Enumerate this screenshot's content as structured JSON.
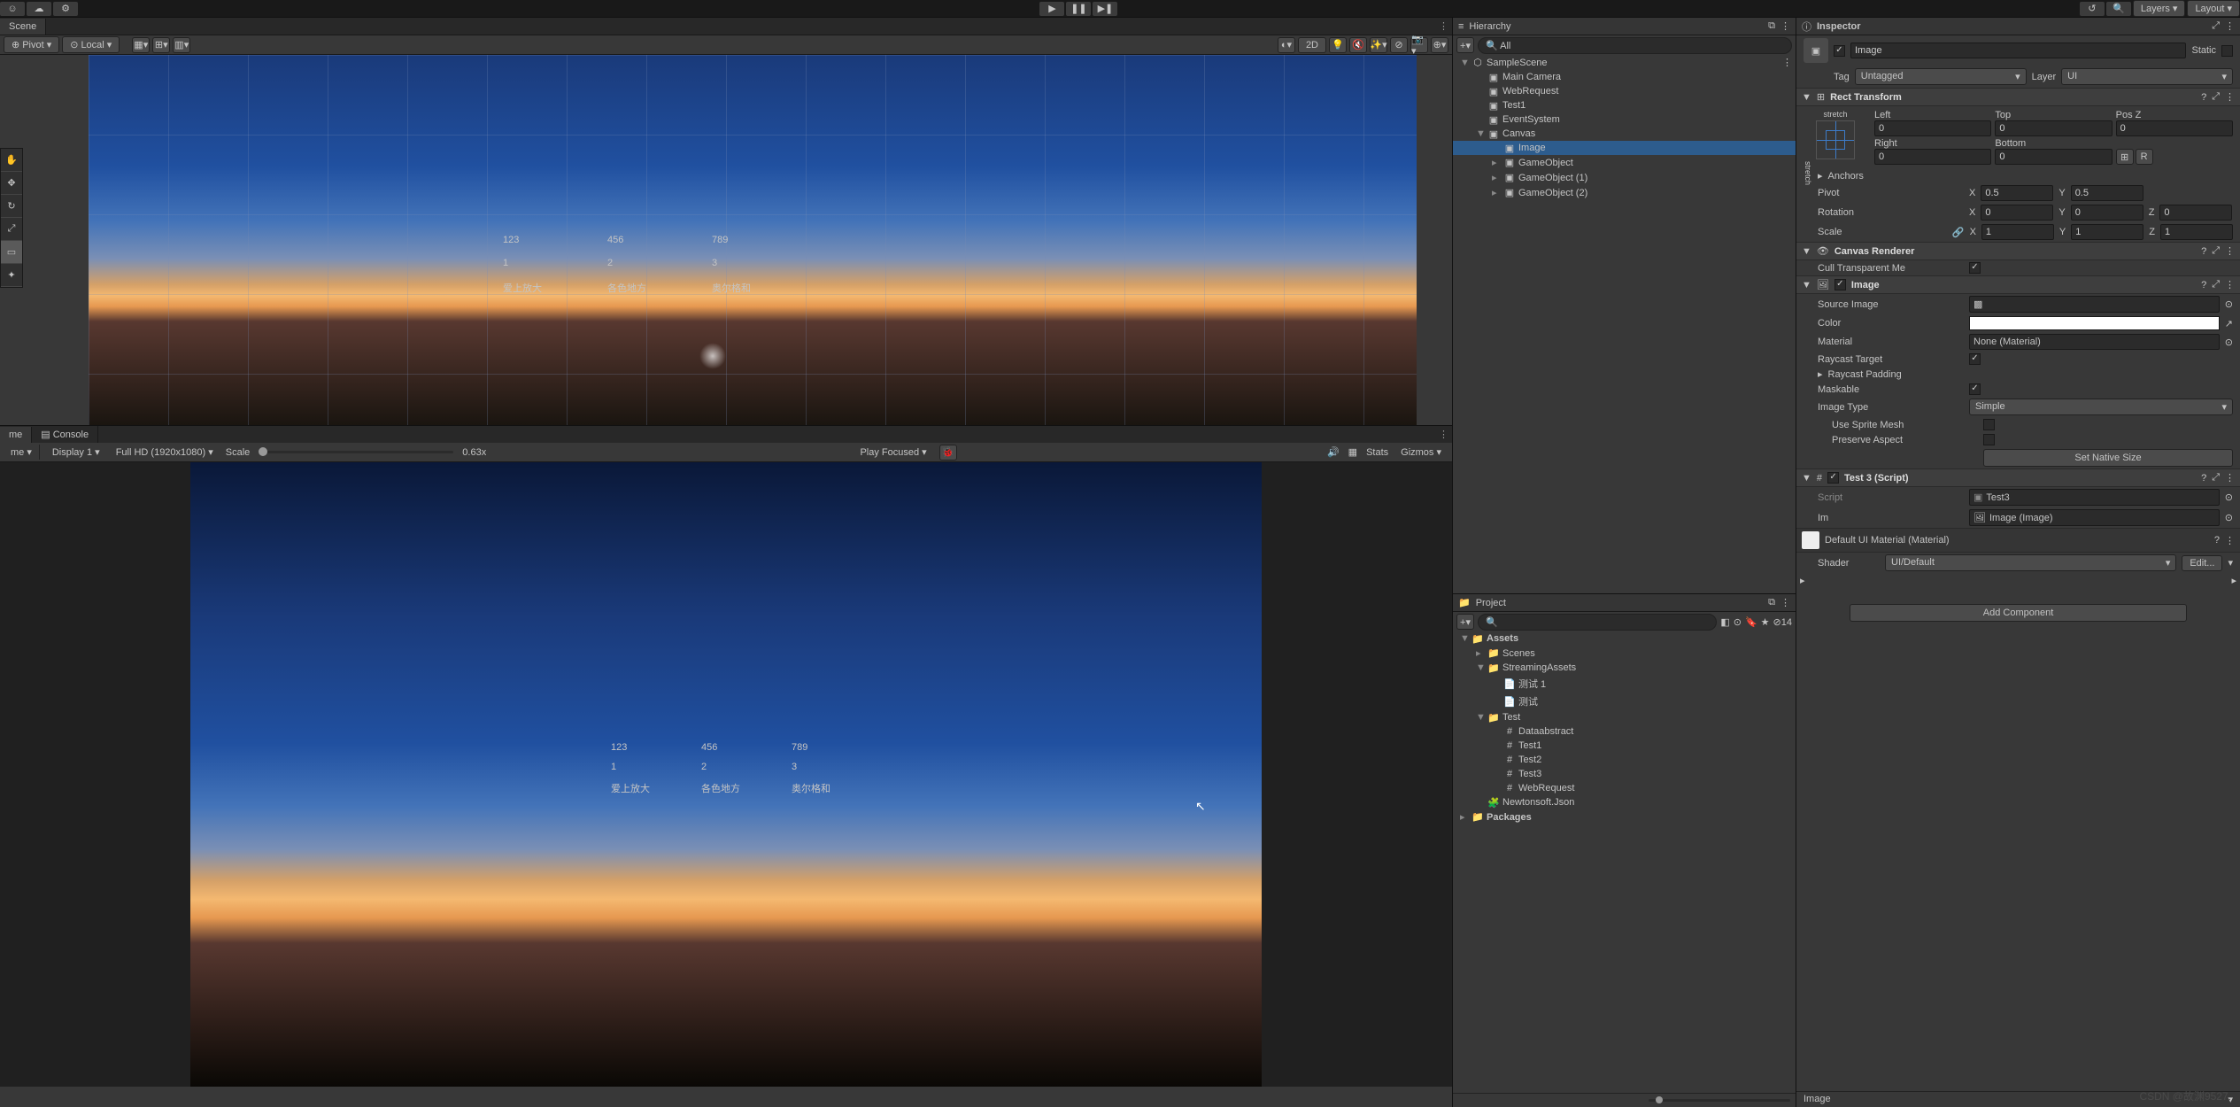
{
  "topbar": {
    "layers": "Layers",
    "layout": "Layout"
  },
  "scene": {
    "tab": "Scene",
    "pivot": "Pivot",
    "local": "Local",
    "twoD": "2D",
    "table": [
      [
        "123",
        "456",
        "789"
      ],
      [
        "1",
        "2",
        "3"
      ],
      [
        "爱上放大",
        "各色地方",
        "奥尔格和"
      ]
    ]
  },
  "game": {
    "tab": "me",
    "console": "Console",
    "display": "Display 1",
    "res": "Full HD (1920x1080)",
    "scaleLabel": "Scale",
    "scale": "0.63x",
    "playFocused": "Play Focused",
    "stats": "Stats",
    "gizmos": "Gizmos"
  },
  "hierarchy": {
    "title": "Hierarchy",
    "searchPlaceholder": "All",
    "items": [
      {
        "label": "SampleScene",
        "depth": 0,
        "arrow": "▼",
        "icon": "unity"
      },
      {
        "label": "Main Camera",
        "depth": 1,
        "icon": "cube"
      },
      {
        "label": "WebRequest",
        "depth": 1,
        "icon": "cube"
      },
      {
        "label": "Test1",
        "depth": 1,
        "icon": "cube"
      },
      {
        "label": "EventSystem",
        "depth": 1,
        "icon": "cube"
      },
      {
        "label": "Canvas",
        "depth": 1,
        "arrow": "▼",
        "icon": "cube"
      },
      {
        "label": "Image",
        "depth": 2,
        "icon": "cube",
        "selected": true
      },
      {
        "label": "GameObject",
        "depth": 2,
        "arrow": "▸",
        "icon": "cube"
      },
      {
        "label": "GameObject (1)",
        "depth": 2,
        "arrow": "▸",
        "icon": "cube"
      },
      {
        "label": "GameObject (2)",
        "depth": 2,
        "arrow": "▸",
        "icon": "cube"
      }
    ]
  },
  "project": {
    "title": "Project",
    "hiddenCount": "14",
    "items": [
      {
        "label": "Assets",
        "depth": 0,
        "arrow": "▼",
        "icon": "folder",
        "bold": true
      },
      {
        "label": "Scenes",
        "depth": 1,
        "arrow": "▸",
        "icon": "folder"
      },
      {
        "label": "StreamingAssets",
        "depth": 1,
        "arrow": "▼",
        "icon": "folder"
      },
      {
        "label": "测试 1",
        "depth": 2,
        "icon": "file"
      },
      {
        "label": "测试",
        "depth": 2,
        "icon": "file"
      },
      {
        "label": "Test",
        "depth": 1,
        "arrow": "▼",
        "icon": "folder"
      },
      {
        "label": "Dataabstract",
        "depth": 2,
        "icon": "cs"
      },
      {
        "label": "Test1",
        "depth": 2,
        "icon": "cs"
      },
      {
        "label": "Test2",
        "depth": 2,
        "icon": "cs"
      },
      {
        "label": "Test3",
        "depth": 2,
        "icon": "cs"
      },
      {
        "label": "WebRequest",
        "depth": 2,
        "icon": "cs"
      },
      {
        "label": "Newtonsoft.Json",
        "depth": 1,
        "icon": "puzzle"
      },
      {
        "label": "Packages",
        "depth": 0,
        "arrow": "▸",
        "icon": "folder",
        "bold": true
      }
    ]
  },
  "inspector": {
    "title": "Inspector",
    "name": "Image",
    "static": "Static",
    "tagLabel": "Tag",
    "tag": "Untagged",
    "layerLabel": "Layer",
    "layer": "UI",
    "rect": {
      "title": "Rect Transform",
      "stretch": "stretch",
      "left": "Left",
      "top": "Top",
      "posz": "Pos Z",
      "right": "Right",
      "bottom": "Bottom",
      "leftV": "0",
      "topV": "0",
      "poszV": "0",
      "rightV": "0",
      "bottomV": "0",
      "anchors": "Anchors",
      "pivot": "Pivot",
      "pivotX": "0.5",
      "pivotY": "0.5",
      "rotation": "Rotation",
      "rotX": "0",
      "rotY": "0",
      "rotZ": "0",
      "scale": "Scale",
      "scX": "1",
      "scY": "1",
      "scZ": "1"
    },
    "canvasRenderer": {
      "title": "Canvas Renderer",
      "cull": "Cull Transparent Me"
    },
    "image": {
      "title": "Image",
      "sourceImage": "Source Image",
      "color": "Color",
      "material": "Material",
      "materialV": "None (Material)",
      "raycastTarget": "Raycast Target",
      "raycastPadding": "Raycast Padding",
      "maskable": "Maskable",
      "imageType": "Image Type",
      "imageTypeV": "Simple",
      "useSpriteMesh": "Use Sprite Mesh",
      "preserveAspect": "Preserve Aspect",
      "setNative": "Set Native Size"
    },
    "script": {
      "title": "Test 3 (Script)",
      "scriptLabel": "Script",
      "scriptV": "Test3",
      "im": "Im",
      "imV": "Image (Image)"
    },
    "material": {
      "title": "Default UI Material (Material)",
      "shader": "Shader",
      "shaderV": "UI/Default",
      "edit": "Edit..."
    },
    "addComponent": "Add Component",
    "footer": "Image"
  },
  "watermark": "CSDN @故渊9527."
}
